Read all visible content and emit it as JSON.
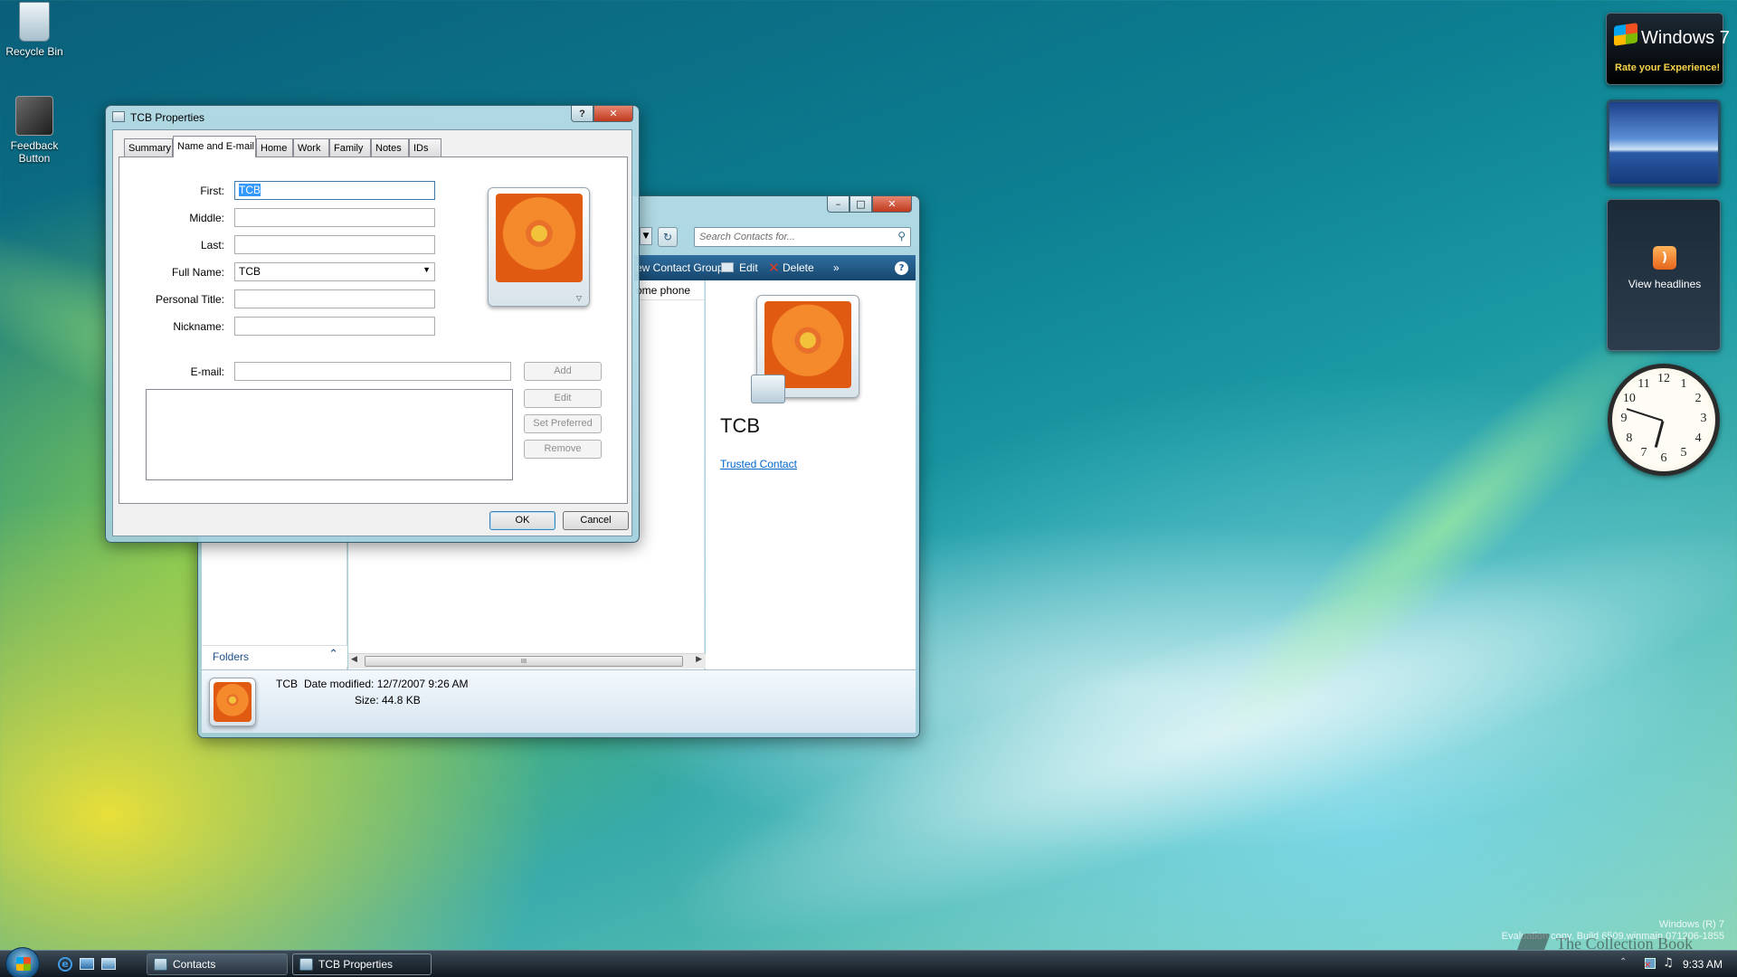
{
  "desktop": {
    "icons": [
      {
        "label": "Recycle Bin",
        "icon": "recycle-bin-icon"
      },
      {
        "label": "Feedback Button",
        "icon": "feedback-icon"
      }
    ],
    "watermark": {
      "build_line1": "Windows (R) 7",
      "build_line2": "Evaluation copy. Build 6509.winmain.071206-1855",
      "brand": "The Collection Book"
    }
  },
  "gadgets": {
    "win7_title": "Windows 7",
    "win7_subtitle": "Rate your Experience!",
    "feed_label": "View headlines",
    "clock_numbers": [
      "12",
      "1",
      "2",
      "3",
      "4",
      "5",
      "6",
      "7",
      "8",
      "9",
      "10",
      "11"
    ]
  },
  "contacts_window": {
    "search_placeholder": "Search Contacts for...",
    "commands": [
      "ew Contact Group",
      "Edit",
      "Delete",
      "»"
    ],
    "column_header": "ome phone",
    "preview_name": "TCB",
    "preview_link": "Trusted Contact",
    "folders_label": "Folders",
    "scroll_grip": "III",
    "details": {
      "name": "TCB",
      "date_modified": "Date modified: 12/7/2007 9:26 AM",
      "size": "Size: 44.8 KB"
    }
  },
  "dialog": {
    "title": "TCB Properties",
    "help": "?",
    "close": "✕",
    "tabs": [
      "Summary",
      "Name and E-mail",
      "Home",
      "Work",
      "Family",
      "Notes",
      "IDs"
    ],
    "active_tab": "Name and E-mail",
    "labels": {
      "first": "First:",
      "middle": "Middle:",
      "last": "Last:",
      "full_name": "Full Name:",
      "personal_title": "Personal Title:",
      "nickname": "Nickname:",
      "email": "E-mail:"
    },
    "values": {
      "first": "TCB",
      "middle": "",
      "last": "",
      "full_name": "TCB",
      "personal_title": "",
      "nickname": "",
      "email": ""
    },
    "email_buttons": [
      "Add",
      "Edit",
      "Set Preferred",
      "Remove"
    ],
    "ok": "OK",
    "cancel": "Cancel"
  },
  "taskbar": {
    "buttons": [
      {
        "label": "Contacts",
        "active": false
      },
      {
        "label": "TCB Properties",
        "active": true
      }
    ],
    "time": "9:33 AM"
  },
  "colors": {
    "accent_blue": "#1e5799",
    "link": "#0066cc",
    "selection": "#3399ff"
  }
}
